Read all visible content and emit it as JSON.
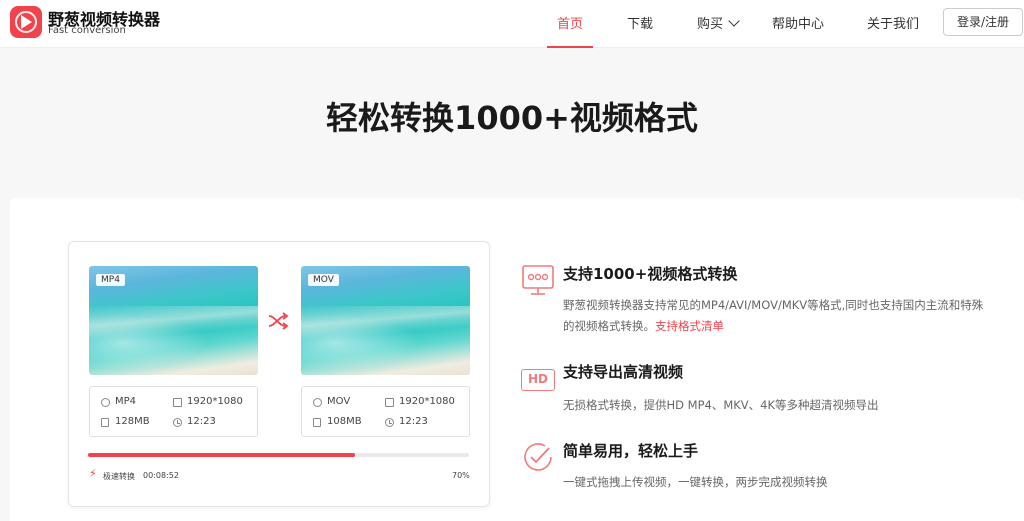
{
  "header": {
    "brand_title": "野葱视频转换器",
    "brand_sub": "Fast conversion",
    "nav": {
      "home": "首页",
      "download": "下载",
      "buy": "购买",
      "help": "帮助中心",
      "about": "关于我们"
    },
    "login_label": "登录/注册"
  },
  "hero": {
    "title": "轻松转换1000+视频格式"
  },
  "converter": {
    "source": {
      "format_tag": "MP4",
      "format": "MP4",
      "resolution": "1920*1080",
      "size": "128MB",
      "duration": "12:23"
    },
    "target": {
      "format_tag": "MOV",
      "format": "MOV",
      "resolution": "1920*1080",
      "size": "108MB",
      "duration": "12:23"
    },
    "speed_label": "极速转换",
    "elapsed": "00:08:52",
    "progress_percent": 70,
    "progress_text": "70%"
  },
  "features": [
    {
      "icon": "monitor-icon",
      "title": "支持1000+视频格式转换",
      "desc": "野葱视频转换器支持常见的MP4/AVI/MOV/MKV等格式,同时也支持国内主流和特殊的视频格式转换。",
      "link": "支持格式清单"
    },
    {
      "icon": "hd-icon",
      "icon_text": "HD",
      "title": "支持导出高清视频",
      "desc": "无损格式转换，提供HD MP4、MKV、4K等多种超清视频导出"
    },
    {
      "icon": "check-circle-icon",
      "title": "简单易用，轻松上手",
      "desc": "一键式拖拽上传视频，一键转换，两步完成视频转换"
    }
  ],
  "colors": {
    "accent": "#f0434b",
    "accent_light": "#f07a7f"
  }
}
